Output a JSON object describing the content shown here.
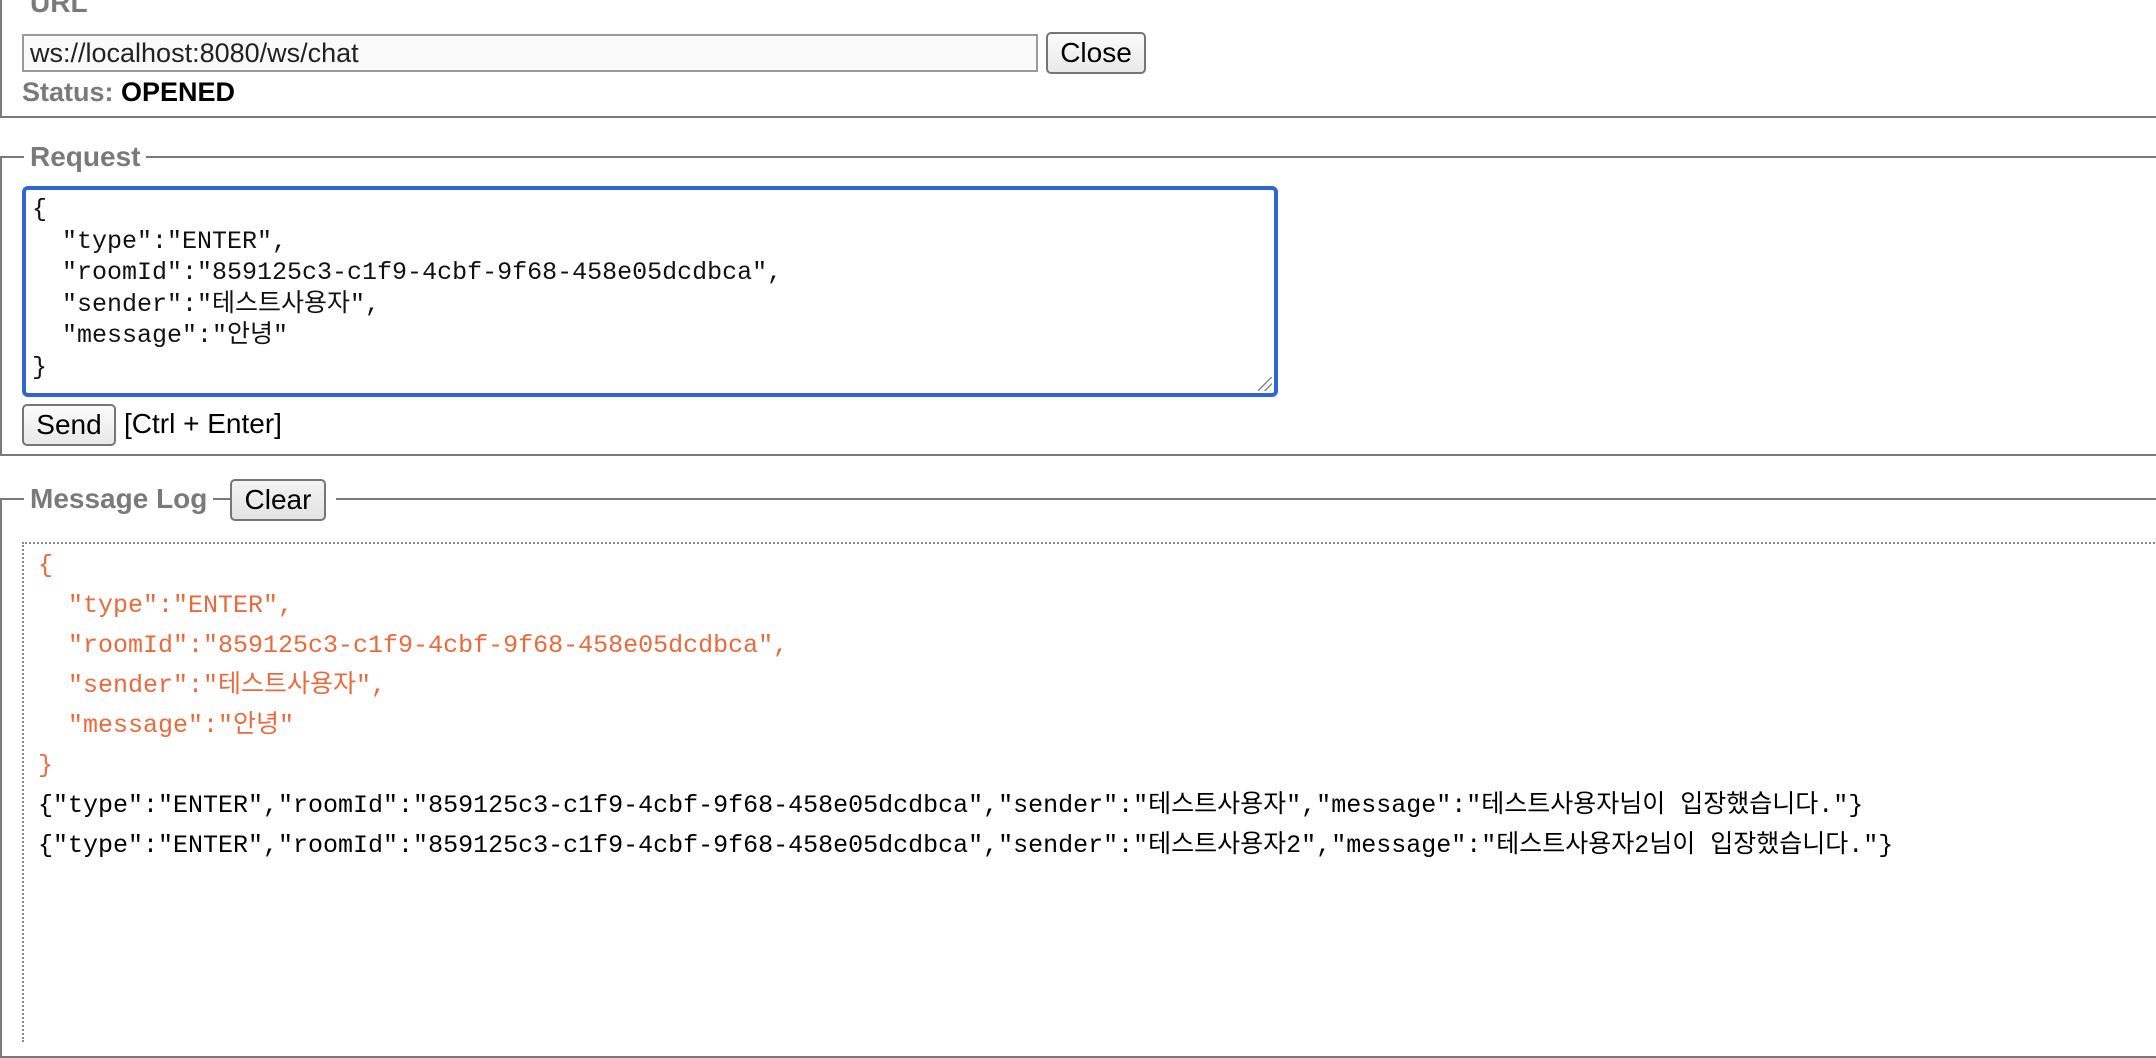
{
  "url_section": {
    "legend": "URL",
    "url_value": "ws://localhost:8080/ws/chat",
    "close_label": "Close",
    "status_label": "Status:",
    "status_value": "OPENED"
  },
  "request_section": {
    "legend": "Request",
    "request_lines": [
      "{",
      "  \"type\":\"ENTER\",",
      "  \"roomId\":\"859125c3-c1f9-4cbf-9f68-458e05dcdbca\",",
      "  \"sender\":\"테스트사용자\",",
      "  \"message\":\"안녕\"",
      "}"
    ],
    "send_label": "Send",
    "shortcut_hint": "[Ctrl + Enter]"
  },
  "log_section": {
    "legend": "Message Log",
    "clear_label": "Clear",
    "sent_lines": [
      "{",
      "  \"type\":\"ENTER\",",
      "  \"roomId\":\"859125c3-c1f9-4cbf-9f68-458e05dcdbca\",",
      "  \"sender\":\"테스트사용자\",",
      "  \"message\":\"안녕\"",
      "}"
    ],
    "received_lines": [
      "{\"type\":\"ENTER\",\"roomId\":\"859125c3-c1f9-4cbf-9f68-458e05dcdbca\",\"sender\":\"테스트사용자\",\"message\":\"테스트사용자님이 입장했습니다.\"}",
      "{\"type\":\"ENTER\",\"roomId\":\"859125c3-c1f9-4cbf-9f68-458e05dcdbca\",\"sender\":\"테스트사용자2\",\"message\":\"테스트사용자2님이 입장했습니다.\"}"
    ]
  },
  "colors": {
    "sent_text": "#ea6a3c",
    "received_text": "#000000",
    "focus_ring": "#2f66d1",
    "legend_text": "#7a7a7a"
  }
}
